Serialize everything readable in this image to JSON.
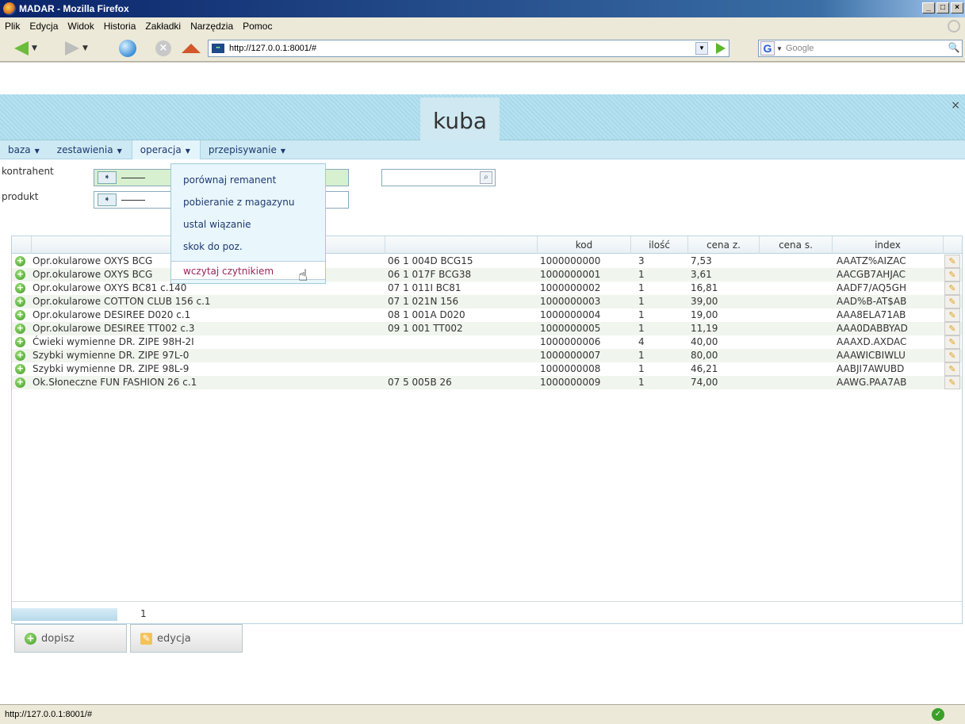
{
  "window": {
    "title": "MADAR - Mozilla Firefox",
    "controls": [
      "_",
      "□",
      "×"
    ]
  },
  "menubar": [
    "Plik",
    "Edycja",
    "Widok",
    "Historia",
    "Zakładki",
    "Narzędzia",
    "Pomoc"
  ],
  "nav": {
    "url": "http://127.0.0.1:8001/#",
    "search_placeholder": "Google",
    "search_engine": "G"
  },
  "app": {
    "tab_title": "kuba",
    "close": "×"
  },
  "topmenu": [
    {
      "label": "baza",
      "arrow": "▼"
    },
    {
      "label": "zestawienia",
      "arrow": "▼"
    },
    {
      "label": "operacja",
      "arrow": "▼"
    },
    {
      "label": "przepisywanie",
      "arrow": "▼"
    }
  ],
  "filters": {
    "kontrahent_label": "kontrahent",
    "produkt_label": "produkt"
  },
  "dropdown": [
    "porównaj remanent",
    "pobieranie z magazynu",
    "ustal wiązanie",
    "skok do poz.",
    "wczytaj czytnikiem"
  ],
  "grid": {
    "headers": [
      "",
      "",
      "kod",
      "ilość",
      "cena z.",
      "cena s.",
      "index"
    ],
    "rows": [
      {
        "name": "Opr.okularowe OXYS BCG",
        "code": "06 1 004D BCG15",
        "kod": "1000000000",
        "qty": "3",
        "price": "7,53",
        "index": "AAATZ%AIZAC"
      },
      {
        "name": "Opr.okularowe OXYS BCG",
        "code": "06 1 017F BCG38",
        "kod": "1000000001",
        "qty": "1",
        "price": "3,61",
        "index": "AACGB7AHJAC"
      },
      {
        "name": "Opr.okularowe OXYS BC81 c.140",
        "code": "07 1 011I BC81",
        "kod": "1000000002",
        "qty": "1",
        "price": "16,81",
        "index": "AADF7/AQ5GH"
      },
      {
        "name": "Opr.okularowe COTTON CLUB 156 c.1",
        "code": "07 1 021N 156",
        "kod": "1000000003",
        "qty": "1",
        "price": "39,00",
        "index": "AAD%B-AT$AB"
      },
      {
        "name": "Opr.okularowe DESIREE D020 c.1",
        "code": "08 1 001A D020",
        "kod": "1000000004",
        "qty": "1",
        "price": "19,00",
        "index": "AAA8ELA71AB"
      },
      {
        "name": "Opr.okularowe DESIREE TT002 c.3",
        "code": "09 1 001 TT002",
        "kod": "1000000005",
        "qty": "1",
        "price": "11,19",
        "index": "AAA0DABBYAD"
      },
      {
        "name": "Ćwieki wymienne DR. ZIPE 98H-2I",
        "code": "",
        "kod": "1000000006",
        "qty": "4",
        "price": "40,00",
        "index": "AAAXD.AXDAC"
      },
      {
        "name": "Szybki wymienne DR. ZIPE 97L-0",
        "code": "",
        "kod": "1000000007",
        "qty": "1",
        "price": "80,00",
        "index": "AAAWICBIWLU"
      },
      {
        "name": "Szybki wymienne DR. ZIPE 98L-9",
        "code": "",
        "kod": "1000000008",
        "qty": "1",
        "price": "46,21",
        "index": "AABJI7AWUBD"
      },
      {
        "name": "Ok.Słoneczne FUN FASHION 26 c.1",
        "code": "07 5 005B 26",
        "kod": "1000000009",
        "qty": "1",
        "price": "74,00",
        "index": "AAWG.PAA7AB"
      }
    ],
    "page": "1"
  },
  "actions": {
    "add": "dopisz",
    "edit": "edycja"
  },
  "status": {
    "url": "http://127.0.0.1:8001/#"
  }
}
